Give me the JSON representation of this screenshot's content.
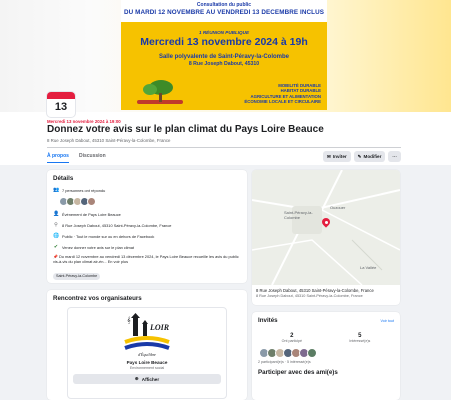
{
  "poster": {
    "consultation": "Consultation du public",
    "period": "DU MARDI 12 NOVEMBRE AU VENDREDI 13 DECEMBRE INCLUS",
    "meeting_type": "1 RÉUNION PUBLIQUE",
    "meeting_date": "Mercredi 13 novembre 2024 à 19h",
    "venue": "Salle polyvalente de Saint-Péravy-la-Colombe",
    "venue_address": "8 Rue Joseph Dabout, 45310",
    "tags": [
      "MOBILITÉ DURABLE",
      "HABITAT DURABLE",
      "AGRICULTURE ET ALIMENTATION",
      "ÉCONOMIE LOCALE ET CIRCULAIRE"
    ]
  },
  "event": {
    "day": "13",
    "date_line": "Mercredi 13 novembre 2024 à 19:00",
    "title": "Donnez votre avis sur le plan climat du Pays Loire Beauce",
    "subtitle": "8 Rue Joseph Dabout, 45310 Saint-Péravy-la-Colombe, France"
  },
  "tabs": [
    "À propos",
    "Discussion"
  ],
  "actions": {
    "invite": "Inviter",
    "edit": "Modifier",
    "more": "···"
  },
  "details": {
    "heading": "Détails",
    "responded": "7 personnes ont répondu",
    "organizer": "Événement de Pays Loire Beauce",
    "address": "8 Rue Joseph Dabout, 45310 Saint-Péravy-la-Colombe, France",
    "privacy": "Public · Tout le monde sur ou en dehors de Facebook",
    "intro": "Venez donner votre avis sur le plan climat",
    "description": "Du mardi 12 novembre au vendredi 13 décembre 2024, le Pays Loire Beauce recueille les avis du public vis-à-vis du plan climat air-én... En voir plus",
    "chip": "Saint-Péravy-la-Colombe"
  },
  "organizers": {
    "heading": "Rencontrez vos organisateurs",
    "logo_text": "LOIR",
    "logo_sub": "d'Équilibre",
    "name": "Pays Loire Beauce",
    "type": "Environnement social",
    "follow": "Afficher"
  },
  "map": {
    "labels": [
      "Saint-Péravy-la-Colombe",
      "Ouzouer",
      "La Vallée"
    ],
    "address": "8 Rue Joseph Dabout, 45310 Saint-Péravy-la-Colombe, France",
    "subaddress": "8 Rue Joseph Dabout, 45310 Saint-Péravy-la-Colombe, France"
  },
  "invites": {
    "heading": "Invités",
    "see_all": "Voir tout",
    "going_count": "2",
    "going_label": "Ont participé",
    "interested_count": "5",
    "interested_label": "Intéressé(e)s",
    "summary": "2 participant(e)s · 5 intéressé(e)s"
  },
  "friends": {
    "heading": "Participer avec des ami(e)s"
  },
  "colors": {
    "accent": "#1877f2",
    "date_red": "#e41e3f",
    "poster_yellow": "#f6c200",
    "poster_blue": "#1a3aa8"
  }
}
